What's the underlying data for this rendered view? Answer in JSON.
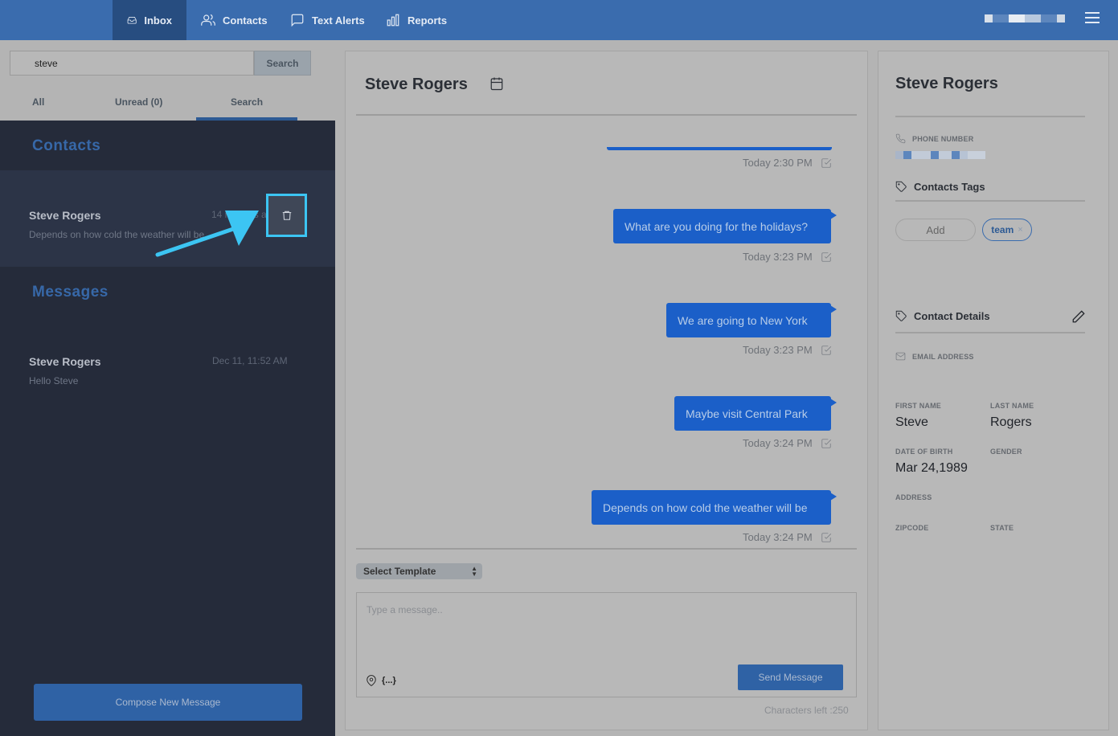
{
  "nav": {
    "items": [
      {
        "label": "Inbox",
        "icon": "inbox-icon",
        "active": true
      },
      {
        "label": "Contacts",
        "icon": "users-icon",
        "active": false
      },
      {
        "label": "Text Alerts",
        "icon": "message-square-icon",
        "active": false
      },
      {
        "label": "Reports",
        "icon": "bar-chart-icon",
        "active": false
      }
    ]
  },
  "search": {
    "value": "steve",
    "button_label": "Search"
  },
  "tabs": [
    {
      "label": "All"
    },
    {
      "label": "Unread (0)"
    },
    {
      "label": "Search",
      "active": true
    }
  ],
  "sidebar": {
    "contacts_title": "Contacts",
    "contact": {
      "name": "Steve Rogers",
      "time": "14 minutes ago",
      "preview": "Depends on how cold the weather will be"
    },
    "messages_title": "Messages",
    "message": {
      "name": "Steve Rogers",
      "time": "Dec 11, 11:52 AM",
      "preview": "Hello Steve"
    },
    "compose_label": "Compose New Message"
  },
  "conversation": {
    "title": "Steve Rogers",
    "messages": [
      {
        "text": "",
        "time": "Today 2:30 PM"
      },
      {
        "text": "What are you doing for the holidays?",
        "time": "Today 3:23 PM"
      },
      {
        "text": "We are going to New York",
        "time": "Today 3:23 PM"
      },
      {
        "text": "Maybe visit Central Park",
        "time": "Today 3:24 PM"
      },
      {
        "text": "Depends on how cold the weather will be",
        "time": "Today 3:24 PM"
      }
    ],
    "template_select": "Select Template",
    "input_placeholder": "Type a message..",
    "variable_label": "{...}",
    "send_label": "Send Message",
    "chars_left": "Characters left :250"
  },
  "contact_panel": {
    "name": "Steve Rogers",
    "phone_label": "PHONE NUMBER",
    "tags_title": "Contacts Tags",
    "add_label": "Add",
    "tags": [
      "team"
    ],
    "tag_remove_glyph": "×",
    "details_title": "Contact Details",
    "email_label": "EMAIL ADDRESS",
    "first_name_label": "FIRST NAME",
    "first_name": "Steve",
    "last_name_label": "LAST NAME",
    "last_name": "Rogers",
    "dob_label": "DATE OF BIRTH",
    "dob": "Mar 24,1989",
    "gender_label": "GENDER",
    "address_label": "ADDRESS",
    "zipcode_label": "ZIPCODE",
    "state_label": "STATE"
  },
  "colors": {
    "nav_bg": "#3a6cae",
    "nav_active": "#274d80",
    "sidebar_dark": "#252b3a",
    "bubble": "#1b5fc8",
    "highlight": "#3cc5f3",
    "section_title": "#3768a8"
  }
}
